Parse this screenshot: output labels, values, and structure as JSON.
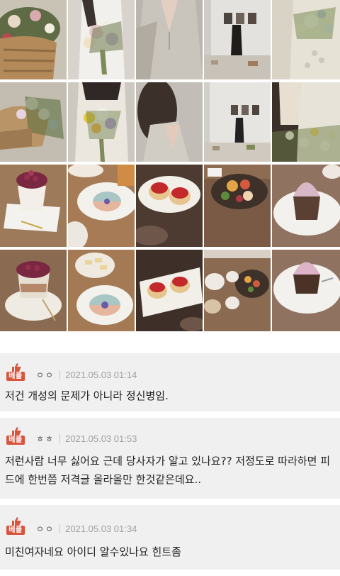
{
  "photo_grid": {
    "items": [
      "flower-basket-photo",
      "woman-holding-bouquet-photo",
      "knit-sweater-photo",
      "gallery-woman-photo",
      "flowers-lace-blouse-photo",
      "flower-basket-photo-2",
      "woman-holding-flowers-photo",
      "wavy-hair-woman-photo",
      "gallery-woman-photo-2",
      "wildflowers-photo",
      "raspberry-dessert-photo",
      "pastel-plate-photo",
      "strawberry-scones-photo",
      "fruit-salad-bowl-photo",
      "pink-cupcake-photo",
      "raspberry-parfait-photo",
      "pastel-plate-photo-2",
      "scones-on-tray-photo",
      "table-spread-photo",
      "pink-cupcake-photo-2"
    ]
  },
  "comments": [
    {
      "badge": "베플",
      "nick": "ㅇㅇ",
      "date": "2021.05.03 01:14",
      "text": "저건 개성의 문제가 아니라 정신병임."
    },
    {
      "badge": "베플",
      "nick": "ㅎㅎ",
      "date": "2021.05.03 01:53",
      "text": "저런사람 너무 싫어요 근데 당사자가 알고 있나요?? 저정도로 따라하면 피드에 한번쯤 저격글 올라올만 한것같은데요.."
    },
    {
      "badge": "베플",
      "nick": "ㅇㅇ",
      "date": "2021.05.03 01:34",
      "text": "미친여자네요 아이디 알수있나요 힌트좀"
    }
  ],
  "colors": {
    "badge": "#d9533d",
    "comment_bg": "#f0f0f1",
    "date": "#a0a0a0"
  }
}
